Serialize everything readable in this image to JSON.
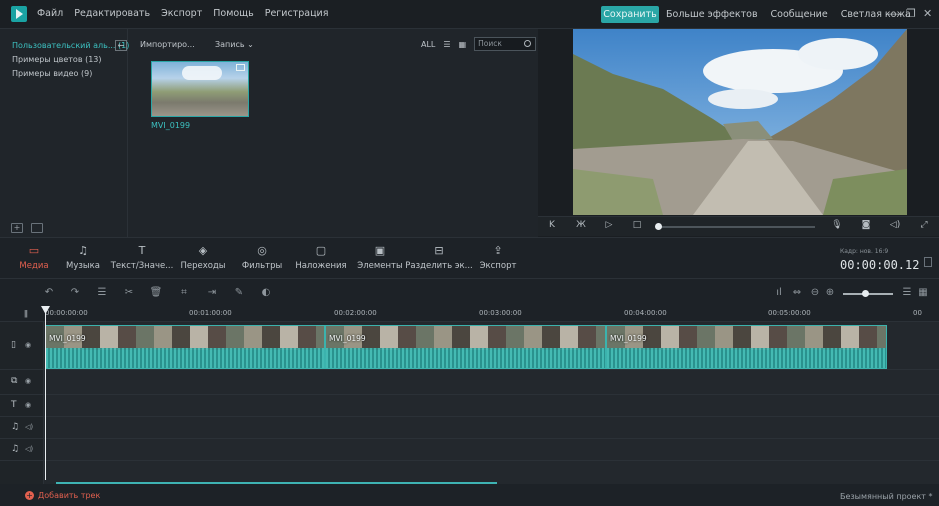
{
  "titlebar": {
    "menu": [
      "Файл",
      "Редактировать",
      "Экспорт",
      "Помощь",
      "Регистрация"
    ],
    "save_label": "Сохранить",
    "links": [
      "Больше эффектов",
      "Сообщение",
      "Светлая кожа"
    ]
  },
  "library": {
    "side_items": [
      "Пользовательский аль... (1)",
      "Примеры цветов (13)",
      "Примеры видео (9)"
    ],
    "import_label": "Импортиро...",
    "record_label": "Запись",
    "filter_label": "ALL",
    "search_placeholder": "Поиск",
    "media": [
      {
        "name": "MVI_0199"
      }
    ]
  },
  "toolbar": {
    "items": [
      "Медиа",
      "Музыка",
      "Текст/Значе...",
      "Переходы",
      "Фильтры",
      "Наложения",
      "Элементы",
      "Разделить эк...",
      "Экспорт"
    ],
    "active_item": "Медиа",
    "ratio_label": "Кадр: нов. 16:9",
    "timecode": "00:00:00.12"
  },
  "timeline": {
    "ruler_ticks": [
      "00:00:00:00",
      "00:01:00:00",
      "00:02:00:00",
      "00:03:00:00",
      "00:04:00:00",
      "00:05:00:00",
      "00"
    ],
    "clips": [
      "MVI_0199",
      "MVI_0199",
      "MVI_0199"
    ]
  },
  "footer": {
    "add_track_label": "Добавить трек",
    "project_name": "Безымянный проект *"
  },
  "colors": {
    "accent": "#2aa6a6",
    "highlight": "#e2604f"
  }
}
